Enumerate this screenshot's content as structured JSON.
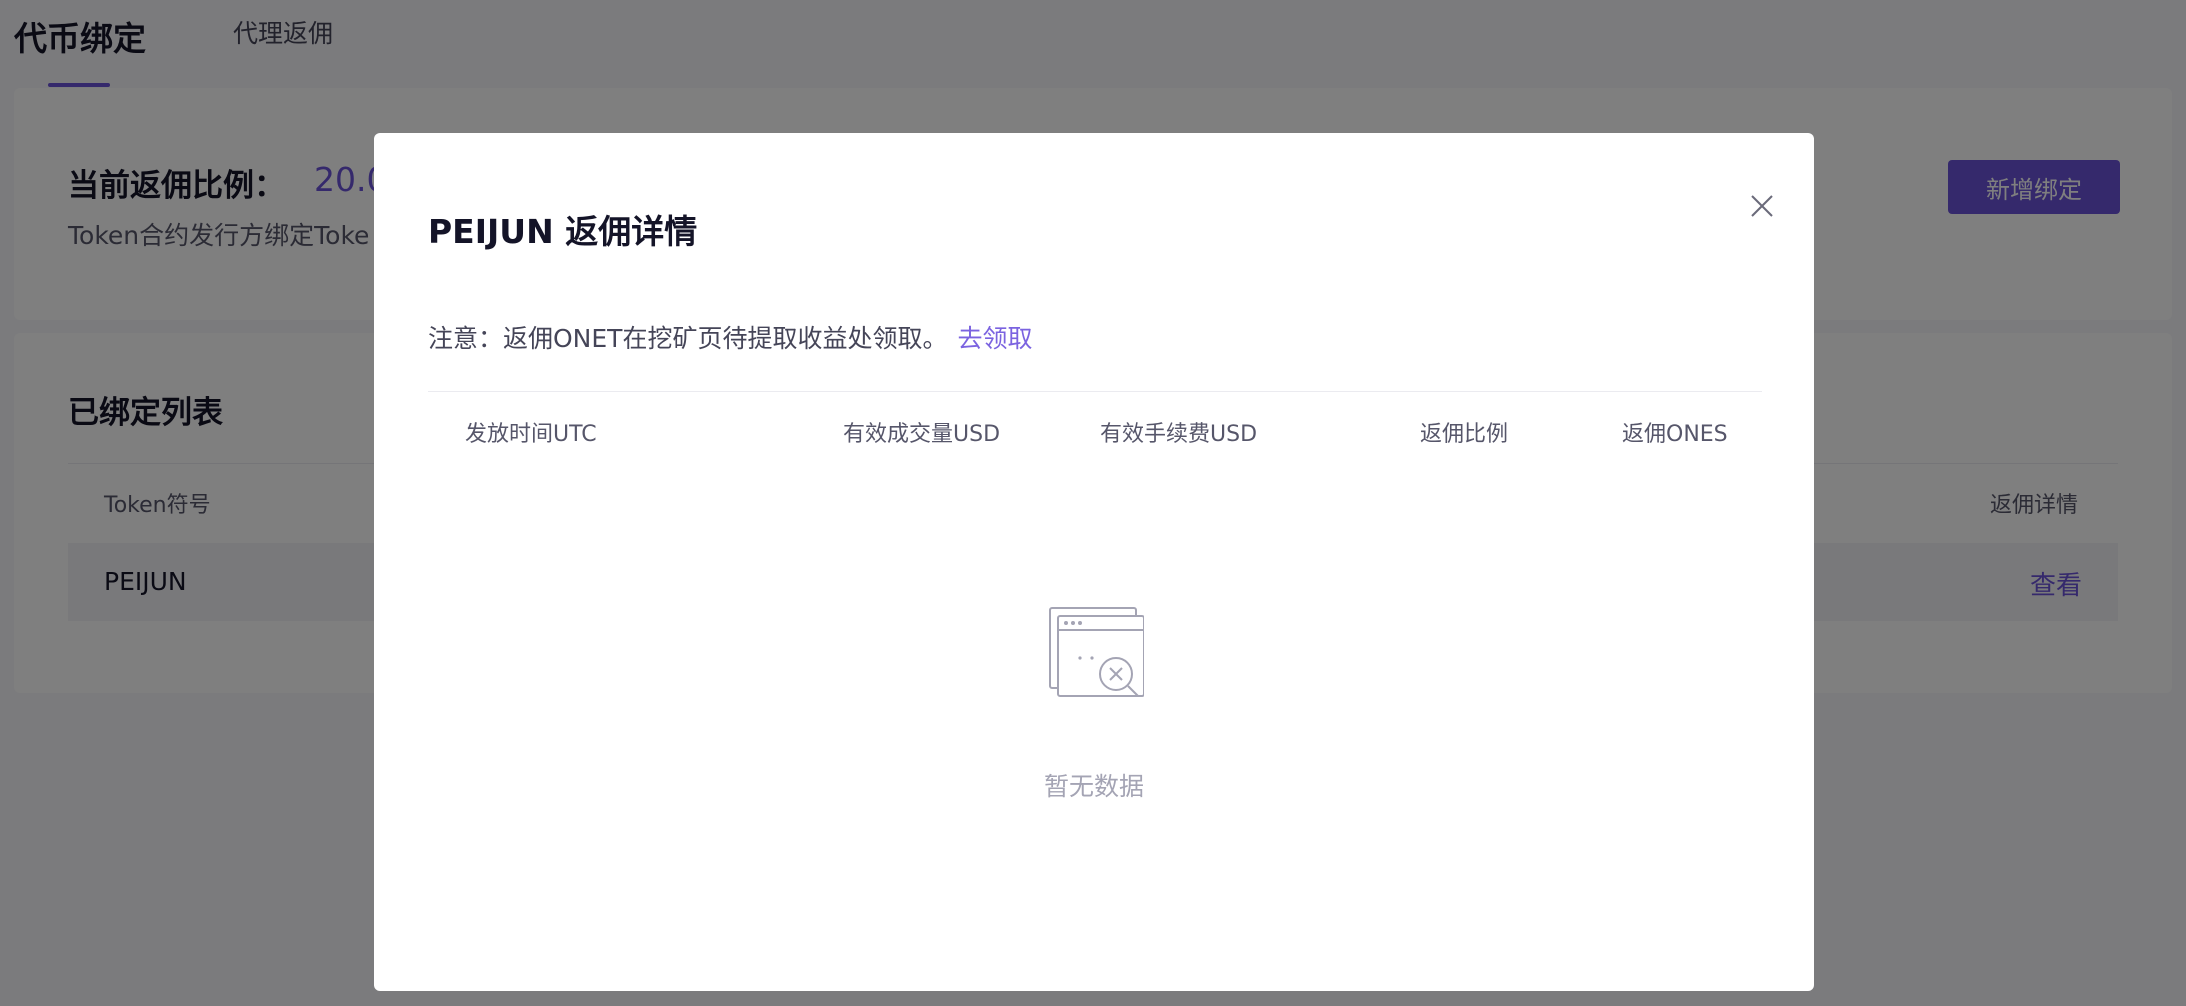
{
  "tabs": {
    "active_label": "代币绑定",
    "agent_label": "代理返佣"
  },
  "rate_card": {
    "label": "当前返佣比例：",
    "value_visible": "20.0",
    "description_visible": "Token合约发行方绑定Toke",
    "add_button": "新增绑定"
  },
  "bound_list": {
    "title": "已绑定列表",
    "columns": {
      "token": "Token符号",
      "detail": "返佣详情"
    },
    "rows": [
      {
        "token": "PEIJUN",
        "action": "查看"
      }
    ]
  },
  "modal": {
    "title": "PEIJUN 返佣详情",
    "notice_text": "注意：返佣ONET在挖矿页待提取收益处领取。",
    "notice_link": "去领取",
    "columns": [
      "发放时间UTC",
      "有效成交量USD",
      "有效手续费USD",
      "返佣比例",
      "返佣ONES"
    ],
    "rows": [],
    "empty_text": "暂无数据",
    "empty_icon": "empty-data-icon",
    "close_icon": "close-icon"
  },
  "colors": {
    "accent": "#6b52d9",
    "overlay": "rgba(0,0,0,0.5)",
    "muted_text": "#a4a4b4"
  }
}
